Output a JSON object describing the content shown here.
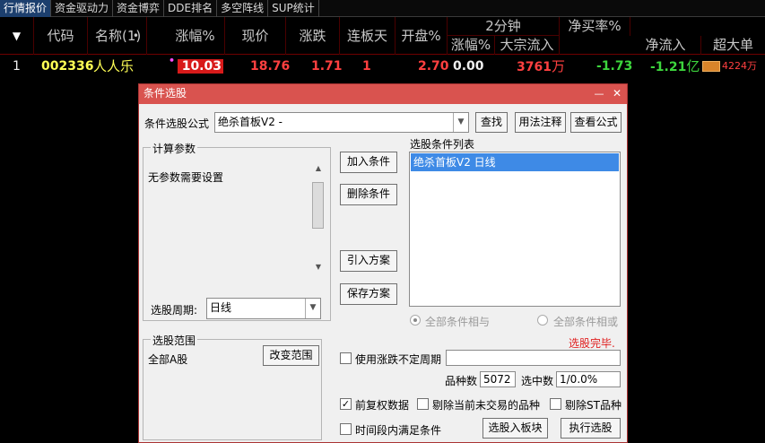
{
  "tabs": [
    "行情报价",
    "资金驱动力",
    "资金博弈",
    "DDE排名",
    "多空阵线",
    "SUP统计"
  ],
  "table": {
    "menu_icon": "▼",
    "headers": {
      "code": "代码",
      "name": "名称(1)",
      "name_dot": "•",
      "change_pct": "涨幅%",
      "price": "现价",
      "change": "涨跌",
      "limit_days": "连板天",
      "open_pct": "开盘%",
      "two_min": "2分钟",
      "two_min_change": "涨幅%",
      "block_inflow": "大宗流入",
      "net_buy_rate": "净买率%",
      "net_inflow": "净流入",
      "super_large": "超大单"
    },
    "row": {
      "index": "1",
      "code": "002336",
      "name": "人人乐",
      "marker": "•",
      "change_pct": "10.03",
      "price": "18.76",
      "change": "1.71",
      "limit_days": "1",
      "open_pct": "2.70",
      "two_min_change": "0.00",
      "block_inflow_value": "3761",
      "block_inflow_unit": "万",
      "net_buy_rate": "-1.73",
      "net_inflow_value": "-1.21",
      "net_inflow_unit": "亿",
      "super_large": "4224万"
    }
  },
  "dialog": {
    "title": "条件选股",
    "minimize_icon": "—",
    "close_icon": "✕",
    "formula_label": "条件选股公式",
    "formula_value": "绝杀首板V2   -",
    "find_button": "查找",
    "usage_button": "用法注释",
    "view_button": "查看公式",
    "params_group": "计算参数",
    "params_text": "无参数需要设置",
    "period_label": "选股周期:",
    "period_value": "日线",
    "add_button": "加入条件",
    "delete_button": "删除条件",
    "import_button": "引入方案",
    "save_button": "保存方案",
    "conditions_title": "选股条件列表",
    "conditions": [
      "绝杀首板V2  日线"
    ],
    "radio_and": "全部条件相与",
    "radio_or": "全部条件相或",
    "status": "选股完毕.",
    "range_group": "选股范围",
    "range_text": "全部A股",
    "change_range_button": "改变范围",
    "use_period_label": "使用涨跌不定周期",
    "count_label": "品种数",
    "count_value": "5072",
    "selected_label": "选中数",
    "selected_value": "1/0.0%",
    "adjust_label": "前复权数据",
    "exclude_untraded_label": "剔除当前未交易的品种",
    "exclude_st_label": "剔除ST品种",
    "time_period_label": "时间段内满足条件",
    "to_block_button": "选股入板块",
    "run_button": "执行选股"
  }
}
